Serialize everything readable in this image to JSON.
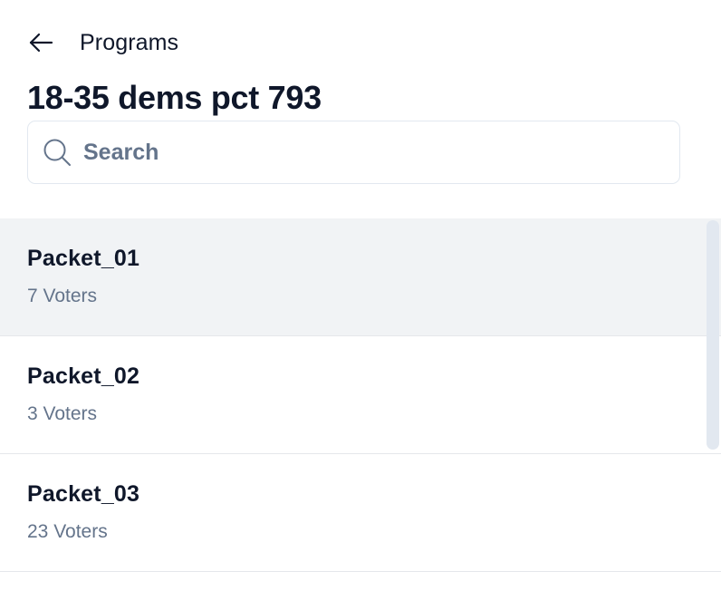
{
  "header": {
    "back_label": "Programs",
    "title": "18-35 dems pct 793"
  },
  "search": {
    "placeholder": "Search",
    "value": ""
  },
  "packets": [
    {
      "name": "Packet_01",
      "voters": "7 Voters",
      "selected": true
    },
    {
      "name": "Packet_02",
      "voters": "3 Voters",
      "selected": false
    },
    {
      "name": "Packet_03",
      "voters": "23 Voters",
      "selected": false
    }
  ],
  "icons": {
    "back": "arrow-left-icon",
    "search": "search-icon"
  },
  "colors": {
    "text_primary": "#0f172a",
    "text_secondary": "#64748b",
    "selected_row": "#f1f3f5",
    "border": "#e2e8f0"
  }
}
